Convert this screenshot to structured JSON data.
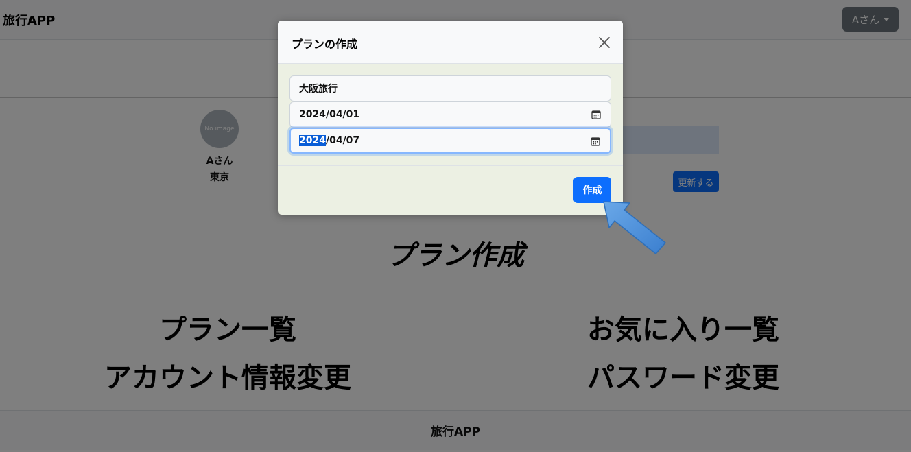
{
  "navbar": {
    "brand": "旅行APP",
    "user_menu": "Aさん"
  },
  "profile": {
    "avatar_text": "No image",
    "name": "Aさん",
    "city": "東京",
    "update_button": "更新する"
  },
  "main": {
    "title": "プラン作成",
    "links": [
      "プラン一覧",
      "お気に入り一覧",
      "アカウント情報変更",
      "パスワード変更"
    ]
  },
  "footer": {
    "brand": "旅行APP"
  },
  "modal": {
    "title": "プランの作成",
    "plan_name": "大阪旅行",
    "start_date": "2024/04/01",
    "end_date_selected": "2024",
    "end_date_rest": "/04/07",
    "submit_button": "作成"
  },
  "colors": {
    "primary": "#0d6efd",
    "navbar_bg": "#f8f9fa",
    "modal_body_bg": "#ecf0e3",
    "arrow": "#4a90d9"
  }
}
